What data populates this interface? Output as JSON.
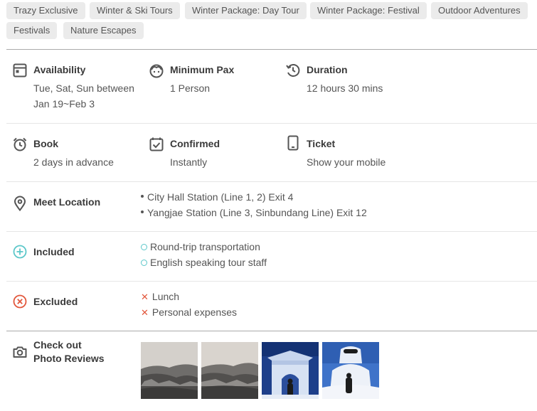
{
  "tags": [
    "Trazy Exclusive",
    "Winter & Ski Tours",
    "Winter Package: Day Tour",
    "Winter Package: Festival",
    "Outdoor Adventures",
    "Festivals",
    "Nature Escapes"
  ],
  "availability": {
    "label": "Availability",
    "value": "Tue, Sat, Sun between Jan 19~Feb 3",
    "icon": "calendar-icon"
  },
  "minimum_pax": {
    "label": "Minimum Pax",
    "value": "1 Person",
    "icon": "person-face-icon"
  },
  "duration": {
    "label": "Duration",
    "value": "12 hours 30 mins",
    "icon": "history-clock-icon"
  },
  "book": {
    "label": "Book",
    "value": "2 days in advance",
    "icon": "alarm-clock-icon"
  },
  "confirmed": {
    "label": "Confirmed",
    "value": "Instantly",
    "icon": "check-box-icon"
  },
  "ticket": {
    "label": "Ticket",
    "value": "Show your mobile",
    "icon": "mobile-phone-icon"
  },
  "meet_location": {
    "label": "Meet Location",
    "icon": "map-pin-icon",
    "items": [
      "City Hall Station (Line 1, 2) Exit 4",
      "Yangjae Station (Line 3, Sinbundang Line) Exit 12"
    ]
  },
  "included": {
    "label": "Included",
    "icon": "plus-circle-icon",
    "items": [
      "Round-trip transportation",
      "English speaking tour staff"
    ]
  },
  "excluded": {
    "label": "Excluded",
    "icon": "x-circle-icon",
    "items": [
      "Lunch",
      "Personal expenses"
    ]
  },
  "reviews": {
    "label_line1": "Check out",
    "label_line2": "Photo Reviews",
    "icon": "camera-icon",
    "photo_count": 4
  },
  "colors": {
    "included_accent": "#5bc7c9",
    "excluded_accent": "#e2563b",
    "tag_bg": "#ebebeb"
  }
}
